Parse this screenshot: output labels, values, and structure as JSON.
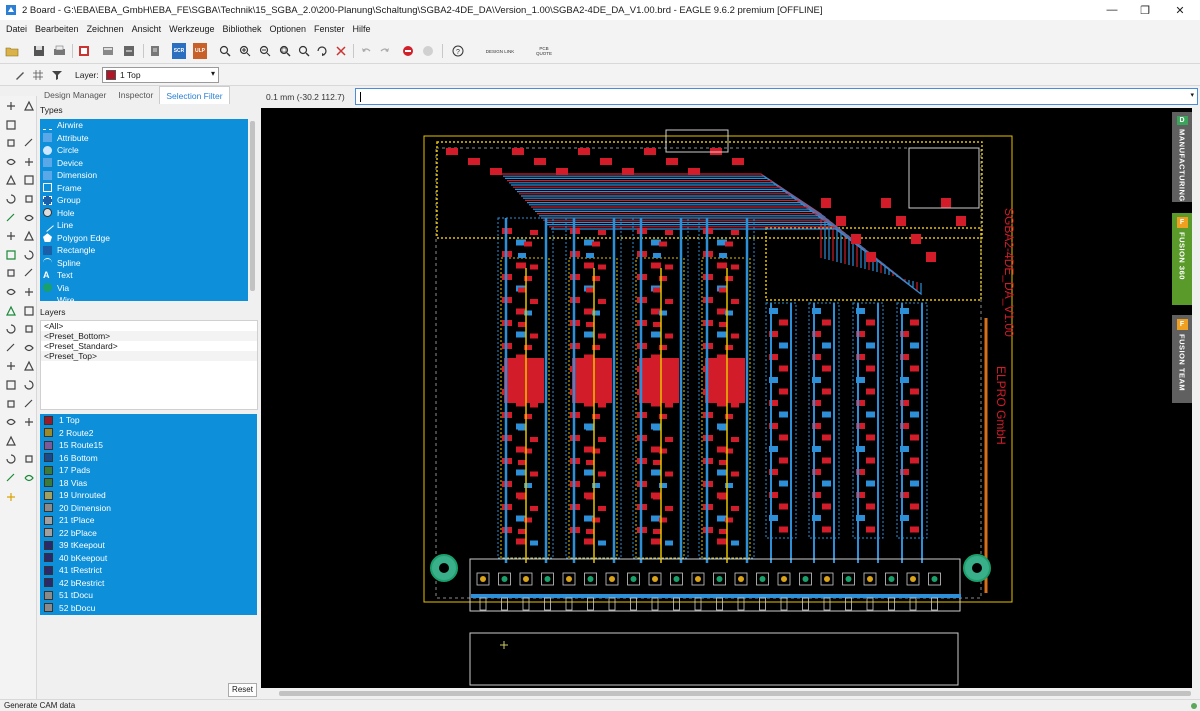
{
  "window": {
    "title": "2 Board - G:\\EBA\\EBA_GmbH\\EBA_FE\\SGBA\\Technik\\15_SGBA_2.0\\200-Planung\\Schaltung\\SGBA2-4DE_DA\\Version_1.00\\SGBA2-4DE_DA_V1.00.brd - EAGLE 9.6.2 premium [OFFLINE]",
    "minimize": "—",
    "maximize": "❐",
    "close": "✕"
  },
  "menu": [
    "Datei",
    "Bearbeiten",
    "Zeichnen",
    "Ansicht",
    "Werkzeuge",
    "Bibliothek",
    "Optionen",
    "Fenster",
    "Hilfe"
  ],
  "toolbar": {
    "scr_label": "SCR",
    "ulp_label": "ULP",
    "design_link": "DESIGN LINK",
    "pcb_quote": "PCB QUOTE"
  },
  "layerbar": {
    "label": "Layer:",
    "selected": "1 Top",
    "selected_color": "#b0182a"
  },
  "panel": {
    "tabs": [
      "Design Manager",
      "Inspector",
      "Selection Filter"
    ],
    "active_tab": "Selection Filter",
    "types_heading": "Types",
    "types": [
      {
        "label": "Airwire",
        "icon": "airwire-icon"
      },
      {
        "label": "Attribute",
        "icon": "attribute-icon"
      },
      {
        "label": "Circle",
        "icon": "circle-icon"
      },
      {
        "label": "Device",
        "icon": "device-icon"
      },
      {
        "label": "Dimension",
        "icon": "dimension-icon"
      },
      {
        "label": "Frame",
        "icon": "frame-icon"
      },
      {
        "label": "Group",
        "icon": "group-icon"
      },
      {
        "label": "Hole",
        "icon": "hole-icon"
      },
      {
        "label": "Line",
        "icon": "line-icon"
      },
      {
        "label": "Polygon Edge",
        "icon": "polygon-edge-icon"
      },
      {
        "label": "Rectangle",
        "icon": "rectangle-icon"
      },
      {
        "label": "Spline",
        "icon": "spline-icon"
      },
      {
        "label": "Text",
        "icon": "text-icon"
      },
      {
        "label": "Via",
        "icon": "via-icon"
      },
      {
        "label": "Wire",
        "icon": "wire-icon"
      }
    ],
    "layers_heading": "Layers",
    "presets": [
      "<All>",
      "<Preset_Bottom>",
      "<Preset_Standard>",
      "<Preset_Top>"
    ],
    "layers": [
      {
        "label": "1 Top",
        "color": "#9b1a2a"
      },
      {
        "label": "2 Route2",
        "color": "#9b8a2a"
      },
      {
        "label": "15 Route15",
        "color": "#7a5a9a"
      },
      {
        "label": "16 Bottom",
        "color": "#1a4a8a"
      },
      {
        "label": "17 Pads",
        "color": "#3a7a3a"
      },
      {
        "label": "18 Vias",
        "color": "#3a7a3a"
      },
      {
        "label": "19 Unrouted",
        "color": "#a0a060"
      },
      {
        "label": "20 Dimension",
        "color": "#8a8a8a"
      },
      {
        "label": "21 tPlace",
        "color": "#a0a0a0"
      },
      {
        "label": "22 bPlace",
        "color": "#a0a0a0"
      },
      {
        "label": "39 tKeepout",
        "color": "#2a2a6a"
      },
      {
        "label": "40 bKeepout",
        "color": "#2a2a6a"
      },
      {
        "label": "41 tRestrict",
        "color": "#2a2a6a"
      },
      {
        "label": "42 bRestrict",
        "color": "#2a2a6a"
      },
      {
        "label": "51 tDocu",
        "color": "#8a8a8a"
      },
      {
        "label": "52 bDocu",
        "color": "#8a8a8a"
      }
    ],
    "reset_label": "Reset"
  },
  "command": {
    "coordinates": "0.1 mm (-30.2 112.7)",
    "value": ""
  },
  "board": {
    "vertical_text_1": "SGBA2-4DE_DA_V1.00",
    "vertical_text_2": "ELPRO GmbH"
  },
  "right_tabs": [
    {
      "label": "MANUFACTURING",
      "icon": "D",
      "color": "#606060",
      "icon_color": "#3aa55a"
    },
    {
      "label": "FUSION 360",
      "icon": "F",
      "color": "#5a9a2a",
      "icon_color": "#f0a020"
    },
    {
      "label": "FUSION TEAM",
      "icon": "F",
      "color": "#606060",
      "icon_color": "#f0a020"
    }
  ],
  "status": {
    "text": "Generate CAM data"
  }
}
